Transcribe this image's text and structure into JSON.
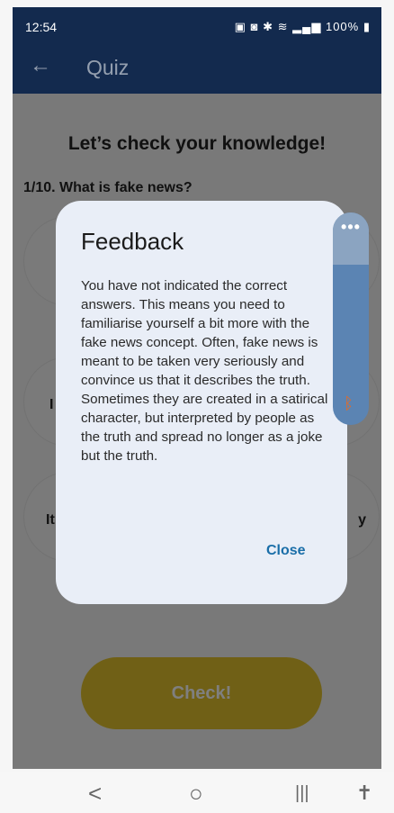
{
  "status_bar": {
    "time": "12:54",
    "battery": "100%",
    "system_icons": [
      "sim-icon",
      "alarm-icon",
      "bluetooth-icon",
      "wifi-icon",
      "signal-icon",
      "battery-icon"
    ]
  },
  "app_bar": {
    "title": "Quiz",
    "back_icon": "arrow-left-icon"
  },
  "quiz": {
    "heading": "Let’s check your knowledge!",
    "question": "1/10. What is fake news?",
    "options": [
      {
        "visible_text": ""
      },
      {
        "visible_text": "I"
      },
      {
        "visible_text": "It",
        "visible_text_right": "y"
      }
    ],
    "check_label": "Check!"
  },
  "dialog": {
    "title": "Feedback",
    "body": "You have not indicated the correct answers. This means you need to familiarise yourself a bit more with the fake news concept. Often, fake news is meant to be taken very seriously and convince us that it describes the truth. Sometimes they are created in a satirical character, but interpreted by people as the truth and spread no longer as a joke but the truth.",
    "close_label": "Close"
  },
  "side_panel": {
    "menu_label": "•••",
    "icon": "bluetooth-icon"
  },
  "nav_bar": {
    "back": "<",
    "home": "○",
    "recents": "|||",
    "accessibility": "✝"
  },
  "colors": {
    "app_bar": "#132a4e",
    "check_button": "#e0c12d",
    "dialog_bg": "#e9eef7",
    "close_text": "#1a6ea8",
    "side_panel": "#5b84b3"
  }
}
